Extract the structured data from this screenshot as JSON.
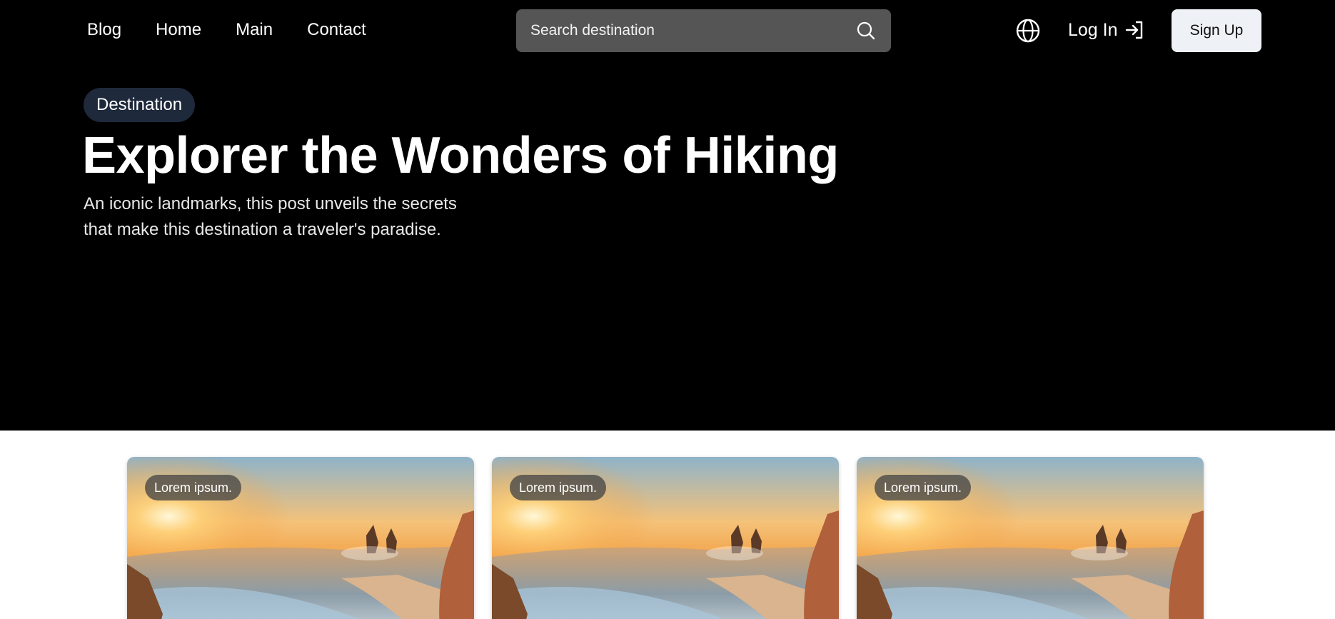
{
  "nav": {
    "links": [
      "Blog",
      "Home",
      "Main",
      "Contact"
    ]
  },
  "search": {
    "placeholder": "Search destination"
  },
  "auth": {
    "login_label": "Log In",
    "signup_label": "Sign Up"
  },
  "hero": {
    "badge": "Destination",
    "title": "Explorer the Wonders of Hiking",
    "description_line1": "An iconic landmarks, this post unveils the secrets",
    "description_line2": "that make this destination a traveler's paradise."
  },
  "cards": [
    {
      "tag": "Lorem ipsum."
    },
    {
      "tag": "Lorem ipsum."
    },
    {
      "tag": "Lorem ipsum."
    }
  ],
  "icons": {
    "search": "search-icon",
    "globe": "globe-icon",
    "login": "login-arrow-icon"
  },
  "colors": {
    "hero_bg": "#000000",
    "search_bg": "#555555",
    "badge_bg": "#1e293b",
    "signup_bg": "#eef2f7"
  }
}
